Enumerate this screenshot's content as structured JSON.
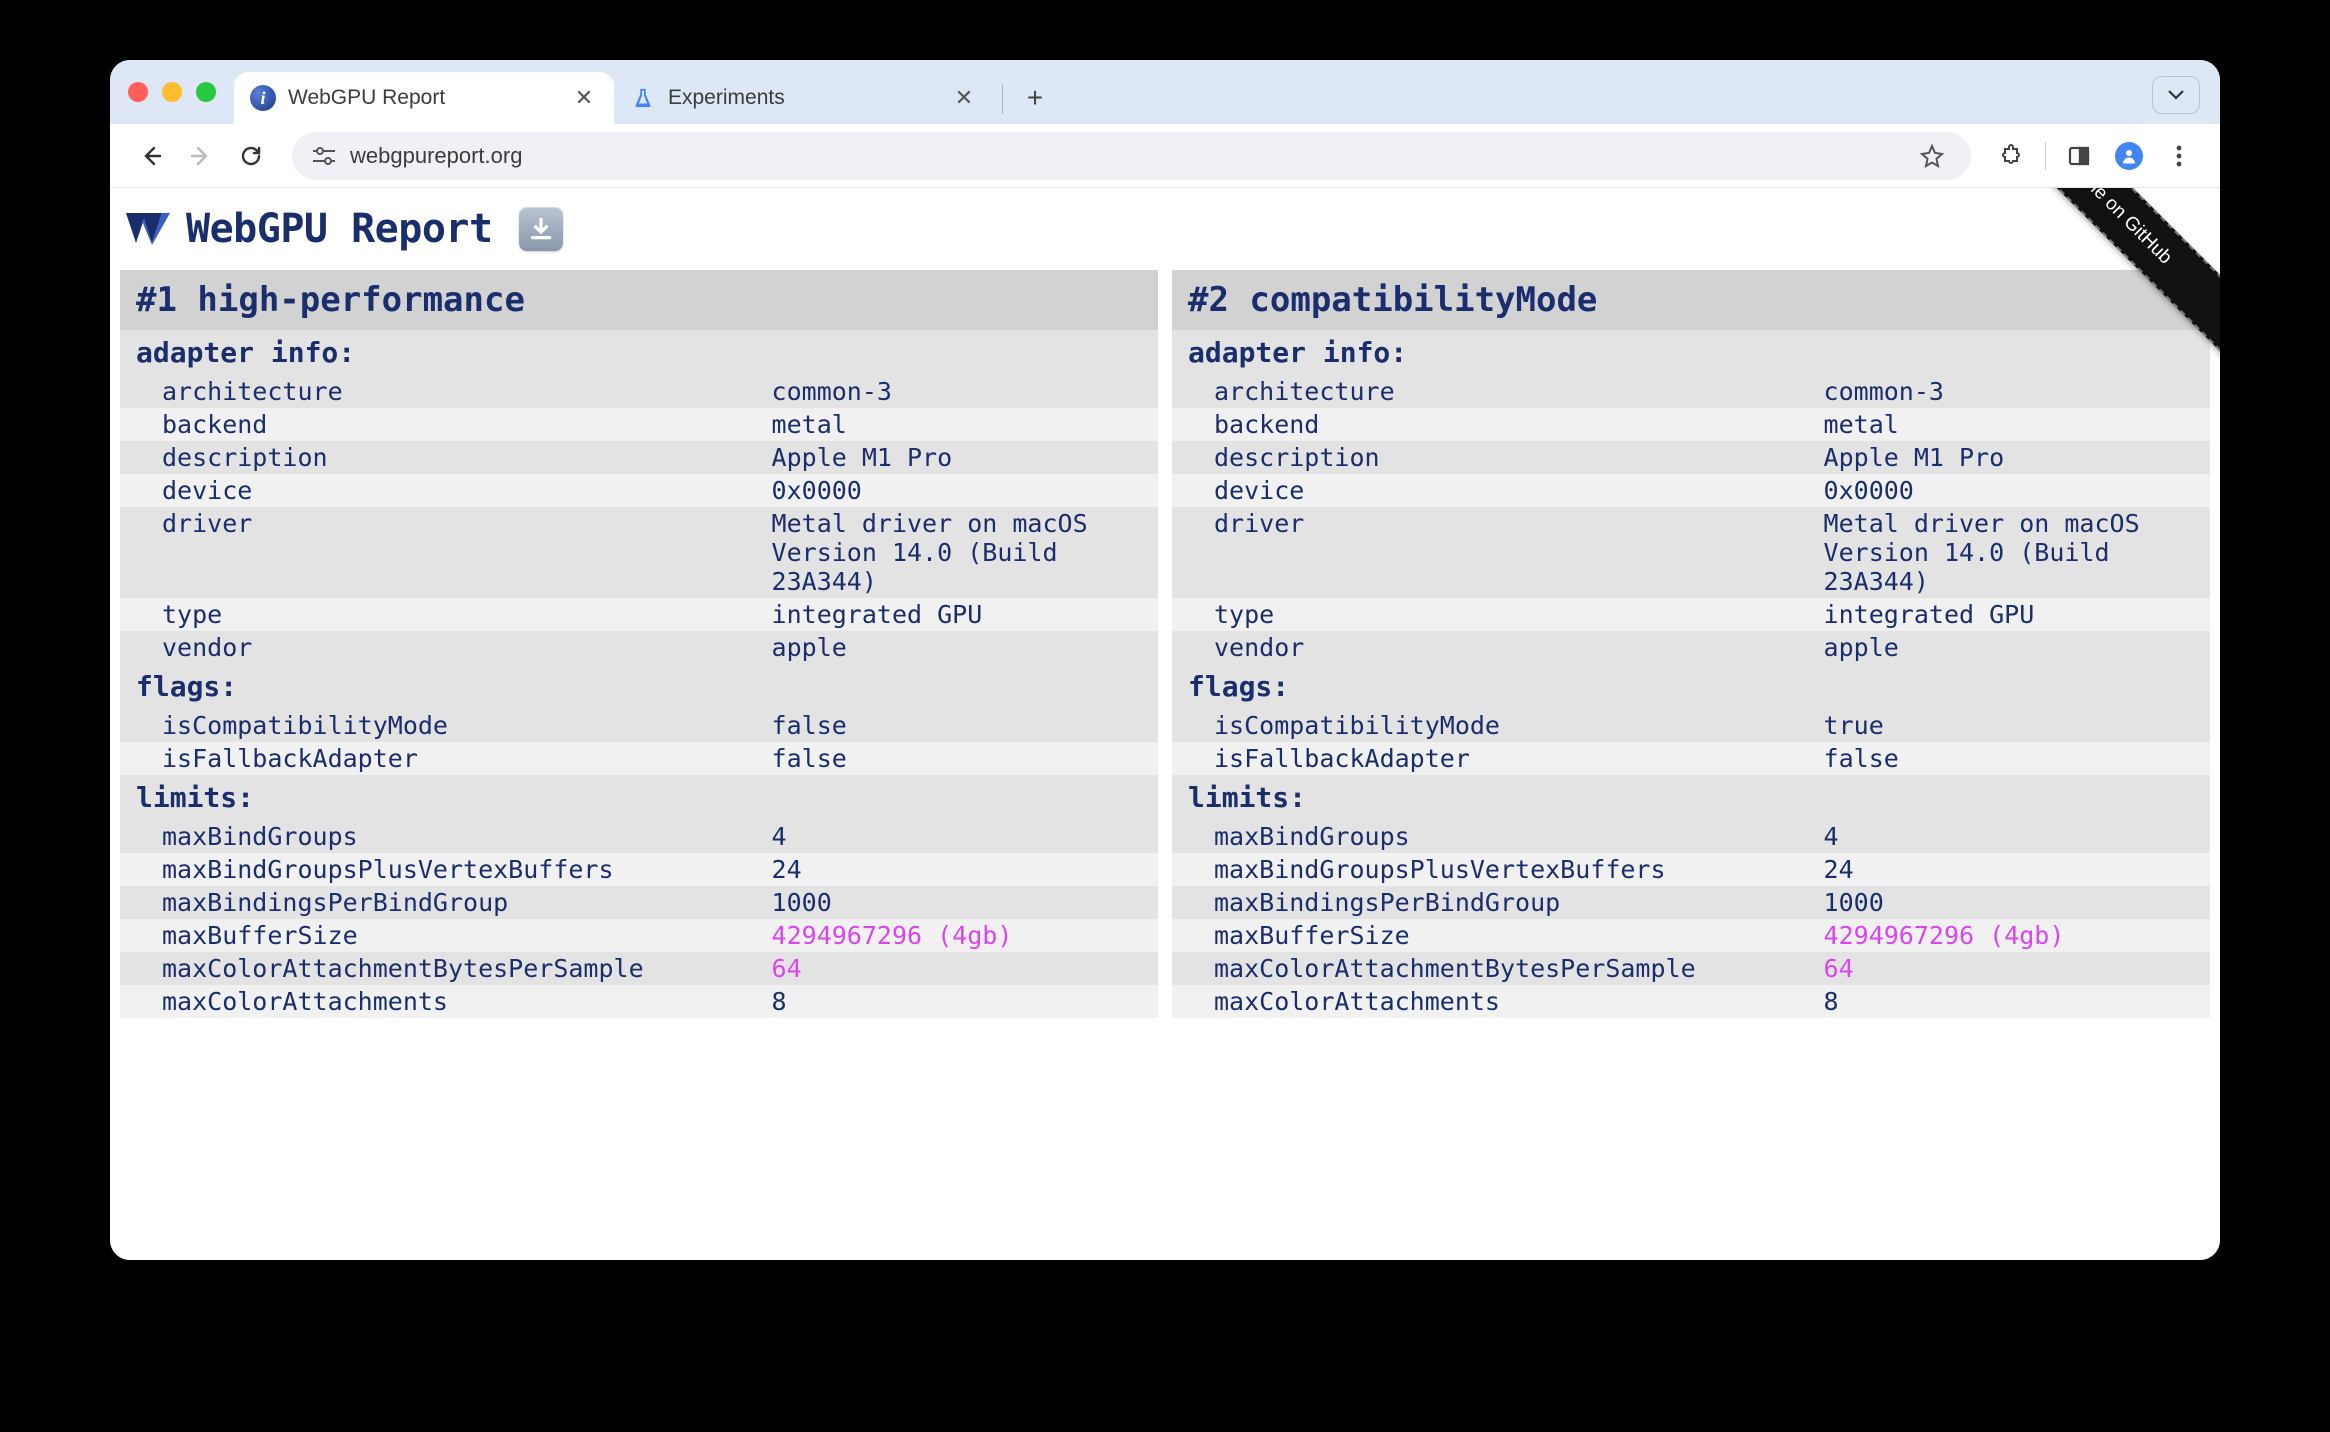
{
  "browser": {
    "tabs": [
      {
        "title": "WebGPU Report",
        "favicon": "info",
        "active": true
      },
      {
        "title": "Experiments",
        "favicon": "flask",
        "active": false
      }
    ],
    "url": "webgpureport.org"
  },
  "page": {
    "title": "WebGPU Report",
    "ribbon": "Fix me on GitHub"
  },
  "adapters": [
    {
      "title": "#1 high-performance",
      "sections": [
        {
          "header": "adapter info:",
          "rows": [
            {
              "key": "architecture",
              "val": "common-3"
            },
            {
              "key": "backend",
              "val": "metal"
            },
            {
              "key": "description",
              "val": "Apple M1 Pro"
            },
            {
              "key": "device",
              "val": "0x0000"
            },
            {
              "key": "driver",
              "val": "Metal driver on macOS Version 14.0 (Build 23A344)"
            },
            {
              "key": "type",
              "val": "integrated GPU"
            },
            {
              "key": "vendor",
              "val": "apple"
            }
          ]
        },
        {
          "header": "flags:",
          "rows": [
            {
              "key": "isCompatibilityMode",
              "val": "false"
            },
            {
              "key": "isFallbackAdapter",
              "val": "false"
            }
          ]
        },
        {
          "header": "limits:",
          "rows": [
            {
              "key": "maxBindGroups",
              "val": "4"
            },
            {
              "key": "maxBindGroupsPlusVertexBuffers",
              "val": "24"
            },
            {
              "key": "maxBindingsPerBindGroup",
              "val": "1000"
            },
            {
              "key": "maxBufferSize",
              "val": "4294967296 (4gb)",
              "highlight": true
            },
            {
              "key": "maxColorAttachmentBytesPerSample",
              "val": "64",
              "highlight": true
            },
            {
              "key": "maxColorAttachments",
              "val": "8"
            }
          ]
        }
      ]
    },
    {
      "title": "#2 compatibilityMode",
      "sections": [
        {
          "header": "adapter info:",
          "rows": [
            {
              "key": "architecture",
              "val": "common-3"
            },
            {
              "key": "backend",
              "val": "metal"
            },
            {
              "key": "description",
              "val": "Apple M1 Pro"
            },
            {
              "key": "device",
              "val": "0x0000"
            },
            {
              "key": "driver",
              "val": "Metal driver on macOS Version 14.0 (Build 23A344)"
            },
            {
              "key": "type",
              "val": "integrated GPU"
            },
            {
              "key": "vendor",
              "val": "apple"
            }
          ]
        },
        {
          "header": "flags:",
          "rows": [
            {
              "key": "isCompatibilityMode",
              "val": "true"
            },
            {
              "key": "isFallbackAdapter",
              "val": "false"
            }
          ]
        },
        {
          "header": "limits:",
          "rows": [
            {
              "key": "maxBindGroups",
              "val": "4"
            },
            {
              "key": "maxBindGroupsPlusVertexBuffers",
              "val": "24"
            },
            {
              "key": "maxBindingsPerBindGroup",
              "val": "1000"
            },
            {
              "key": "maxBufferSize",
              "val": "4294967296 (4gb)",
              "highlight": true
            },
            {
              "key": "maxColorAttachmentBytesPerSample",
              "val": "64",
              "highlight": true
            },
            {
              "key": "maxColorAttachments",
              "val": "8"
            }
          ]
        }
      ]
    }
  ]
}
